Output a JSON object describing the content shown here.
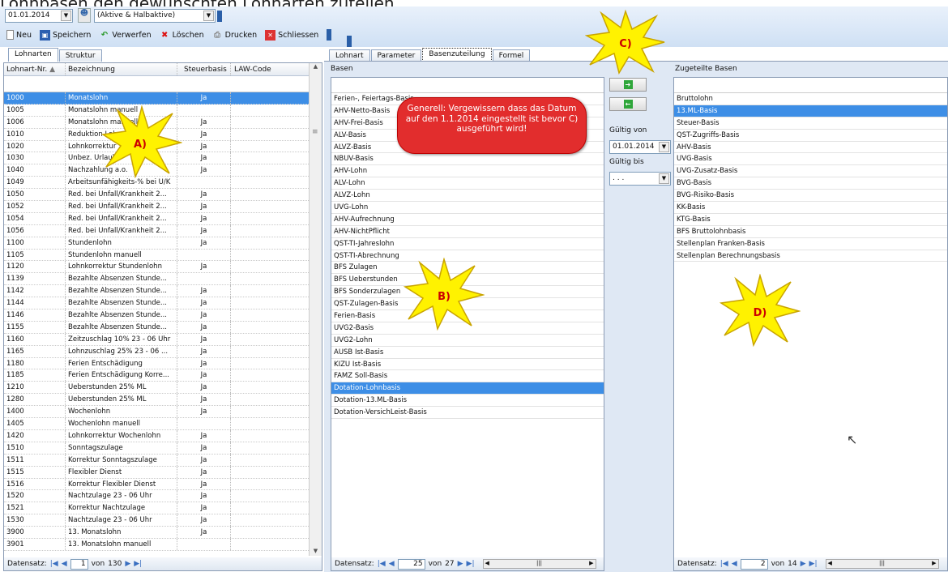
{
  "page": {
    "heading": "Lohnbasen den gewünschten Lohnarten zuteilen"
  },
  "top": {
    "date": "01.01.2014",
    "filter": "(Aktive & Halbaktive)"
  },
  "toolbar": {
    "neu": "Neu",
    "speichern": "Speichern",
    "verwerfen": "Verwerfen",
    "loeschen": "Löschen",
    "drucken": "Drucken",
    "schliessen": "Schliessen"
  },
  "left": {
    "tabs": [
      "Lohnarten",
      "Struktur"
    ],
    "headers": [
      "Lohnart-Nr.",
      "Bezeichnung",
      "Steuerbasis",
      "LAW-Code"
    ],
    "rows": [
      [
        "1000",
        "Monatslohn",
        "Ja",
        ""
      ],
      [
        "1005",
        "Monatslohn manuell",
        "",
        ""
      ],
      [
        "1006",
        "Monatslohn manuell",
        "Ja",
        ""
      ],
      [
        "1010",
        "Reduktion Lohn",
        "Ja",
        ""
      ],
      [
        "1020",
        "Lohnkorrektur",
        "Ja",
        ""
      ],
      [
        "1030",
        "Unbez. Urlaub",
        "Ja",
        ""
      ],
      [
        "1040",
        "Nachzahlung a.o.",
        "Ja",
        ""
      ],
      [
        "1049",
        "Arbeitsunfähigkeits-% bei U/K",
        "",
        ""
      ],
      [
        "1050",
        "Red. bei Unfall/Krankheit 2...",
        "Ja",
        ""
      ],
      [
        "1052",
        "Red. bei Unfall/Krankheit 2...",
        "Ja",
        ""
      ],
      [
        "1054",
        "Red. bei Unfall/Krankheit 2...",
        "Ja",
        ""
      ],
      [
        "1056",
        "Red. bei Unfall/Krankheit 2...",
        "Ja",
        ""
      ],
      [
        "1100",
        "Stundenlohn",
        "Ja",
        ""
      ],
      [
        "1105",
        "Stundenlohn manuell",
        "",
        ""
      ],
      [
        "1120",
        "Lohnkorrektur Stundenlohn",
        "Ja",
        ""
      ],
      [
        "1139",
        "Bezahlte Absenzen Stunde...",
        "",
        ""
      ],
      [
        "1142",
        "Bezahlte Absenzen Stunde...",
        "Ja",
        ""
      ],
      [
        "1144",
        "Bezahlte Absenzen Stunde...",
        "Ja",
        ""
      ],
      [
        "1146",
        "Bezahlte Absenzen Stunde...",
        "Ja",
        ""
      ],
      [
        "1155",
        "Bezahlte Absenzen Stunde...",
        "Ja",
        ""
      ],
      [
        "1160",
        "Zeitzuschlag 10% 23 - 06 Uhr",
        "Ja",
        ""
      ],
      [
        "1165",
        "Lohnzuschlag 25% 23 - 06 ...",
        "Ja",
        ""
      ],
      [
        "1180",
        "Ferien Entschädigung",
        "Ja",
        ""
      ],
      [
        "1185",
        "Ferien Entschädigung Korre...",
        "Ja",
        ""
      ],
      [
        "1210",
        "Ueberstunden 25% ML",
        "Ja",
        ""
      ],
      [
        "1280",
        "Ueberstunden 25% ML",
        "Ja",
        ""
      ],
      [
        "1400",
        "Wochenlohn",
        "Ja",
        ""
      ],
      [
        "1405",
        "Wochenlohn manuell",
        "",
        ""
      ],
      [
        "1420",
        "Lohnkorrektur Wochenlohn",
        "Ja",
        ""
      ],
      [
        "1510",
        "Sonntagszulage",
        "Ja",
        ""
      ],
      [
        "1511",
        "Korrektur Sonntagszulage",
        "Ja",
        ""
      ],
      [
        "1515",
        "Flexibler Dienst",
        "Ja",
        ""
      ],
      [
        "1516",
        "Korrektur Flexibler Dienst",
        "Ja",
        ""
      ],
      [
        "1520",
        "Nachtzulage 23 - 06 Uhr",
        "Ja",
        ""
      ],
      [
        "1521",
        "Korrektur Nachtzulage",
        "Ja",
        ""
      ],
      [
        "1530",
        "Nachtzulage 23 - 06 Uhr",
        "Ja",
        ""
      ],
      [
        "3900",
        "13. Monatslohn",
        "Ja",
        ""
      ],
      [
        "3901",
        "13. Monatslohn manuell",
        "",
        ""
      ]
    ],
    "nav": {
      "label": "Datensatz:",
      "pos": "1",
      "of": "von",
      "total": "130"
    }
  },
  "mid": {
    "tabs": [
      "Lohnart",
      "Parameter",
      "Basenzuteilung",
      "Formel"
    ],
    "header": "Basen",
    "items": [
      "Ferien-, Feiertags-Basis",
      "AHV-Netto-Basis",
      "AHV-Frei-Basis",
      "ALV-Basis",
      "ALVZ-Basis",
      "NBUV-Basis",
      "AHV-Lohn",
      "ALV-Lohn",
      "ALVZ-Lohn",
      "UVG-Lohn",
      "AHV-Aufrechnung",
      "AHV-NichtPflicht",
      "QST-TI-Jahreslohn",
      "QST-TI-Abrechnung",
      "BFS Zulagen",
      "BFS Ueberstunden",
      "BFS Sonderzulagen",
      "QST-Zulagen-Basis",
      "Ferien-Basis",
      "UVG2-Basis",
      "UVG2-Lohn",
      "AUSB Ist-Basis",
      "KIZU Ist-Basis",
      "FAMZ Soll-Basis",
      "Dotation-Lohnbasis",
      "Dotation-13.ML-Basis",
      "Dotation-VersichLeist-Basis"
    ],
    "nav": {
      "label": "Datensatz:",
      "pos": "25",
      "of": "von",
      "total": "27"
    }
  },
  "center": {
    "gueltig_von": "Gültig von",
    "date": "01.01.2014",
    "gueltig_bis": "Gültig bis",
    "bis_value": ". . ."
  },
  "right": {
    "header": "Zugeteilte Basen",
    "items": [
      "Bruttolohn",
      "13.ML-Basis",
      "Steuer-Basis",
      "QST-Zugriffs-Basis",
      "AHV-Basis",
      "UVG-Basis",
      "UVG-Zusatz-Basis",
      "BVG-Basis",
      "BVG-Risiko-Basis",
      "KK-Basis",
      "KTG-Basis",
      "BFS Bruttolohnbasis",
      "Stellenplan Franken-Basis",
      "Stellenplan Berechnungsbasis"
    ],
    "nav": {
      "label": "Datensatz:",
      "pos": "2",
      "of": "von",
      "total": "14"
    }
  },
  "annotations": {
    "a": "A)",
    "b": "B)",
    "c": "C)",
    "d": "D)",
    "callout": "Generell: Vergewissern dass das Datum auf den 1.1.2014 eingestellt ist bevor C) ausgeführt wird!"
  },
  "colors": {
    "selection": "#3d8ee6",
    "callout": "#e22d2d",
    "star": "#fff200"
  }
}
